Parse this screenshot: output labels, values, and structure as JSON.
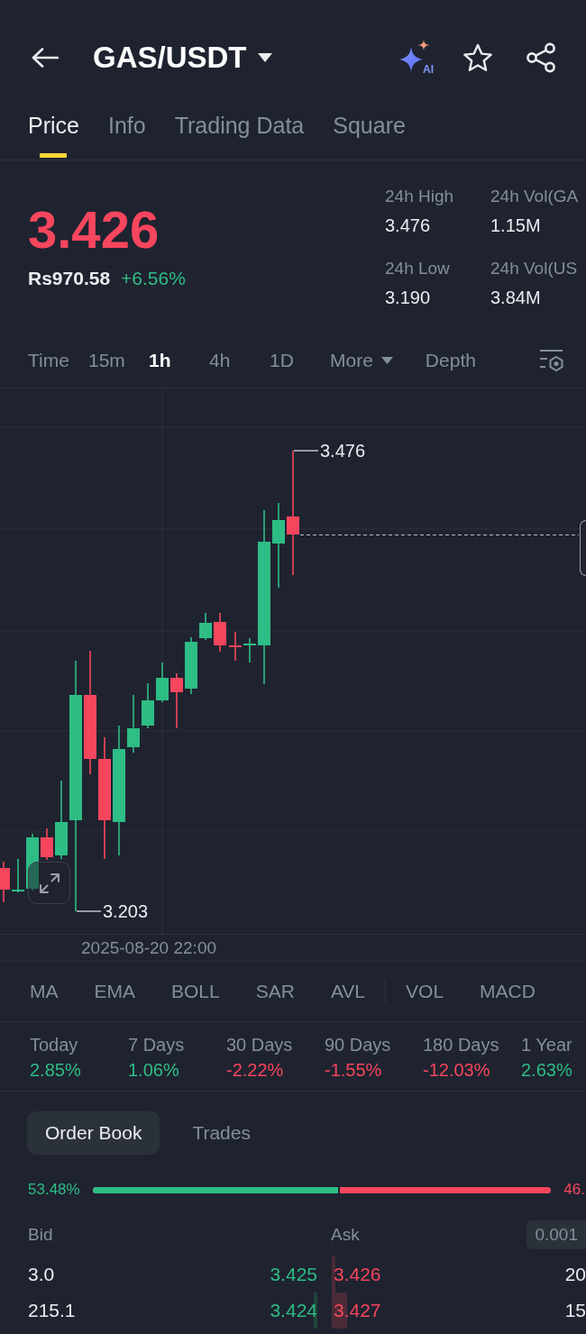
{
  "header": {
    "title": "GAS/USDT",
    "ai_badge": "AI"
  },
  "tabs": [
    {
      "label": "Price",
      "selected": true
    },
    {
      "label": "Info",
      "selected": false
    },
    {
      "label": "Trading Data",
      "selected": false
    },
    {
      "label": "Square",
      "selected": false
    }
  ],
  "ticker": {
    "price": "3.426",
    "price_rising": false,
    "fiat_price": "Rs970.58",
    "change": "+6.56%",
    "change_rising": true
  },
  "stats": [
    {
      "label": "24h High",
      "value": "3.476"
    },
    {
      "label": "24h Vol(GA",
      "value": "1.15M"
    },
    {
      "label": "24h Low",
      "value": "3.190"
    },
    {
      "label": "24h Vol(US",
      "value": "3.84M"
    }
  ],
  "chart_tabs": [
    {
      "label": "Time",
      "selected": false,
      "dropdown": false
    },
    {
      "label": "15m",
      "selected": false,
      "dropdown": false
    },
    {
      "label": "1h",
      "selected": true,
      "dropdown": false
    },
    {
      "label": "4h",
      "selected": false,
      "dropdown": false
    },
    {
      "label": "1D",
      "selected": false,
      "dropdown": false
    },
    {
      "label": "More",
      "selected": false,
      "dropdown": true
    },
    {
      "label": "Depth",
      "selected": false,
      "dropdown": false
    }
  ],
  "chart": {
    "high_label": "3.476",
    "low_label": "3.203",
    "time_label": "2025-08-20 22:00"
  },
  "indicators": {
    "main": [
      "MA",
      "EMA",
      "BOLL",
      "SAR",
      "AVL"
    ],
    "sub": [
      "VOL",
      "MACD"
    ]
  },
  "performance": [
    {
      "label": "Today",
      "value": "2.85%",
      "rising": true
    },
    {
      "label": "7 Days",
      "value": "1.06%",
      "rising": true
    },
    {
      "label": "30 Days",
      "value": "-2.22%",
      "rising": false
    },
    {
      "label": "90 Days",
      "value": "-1.55%",
      "rising": false
    },
    {
      "label": "180 Days",
      "value": "-12.03%",
      "rising": false
    },
    {
      "label": "1 Year",
      "value": "2.63%",
      "rising": true
    }
  ],
  "order_book": {
    "tabs": [
      {
        "label": "Order Book",
        "selected": true
      },
      {
        "label": "Trades",
        "selected": false
      }
    ],
    "bid_ratio": "53.48%",
    "ask_ratio": "46.",
    "level": 0.5348,
    "bid_header": "Bid",
    "ask_header": "Ask",
    "precision": "0.001",
    "rows": [
      {
        "bid": {
          "amount": "3.0",
          "price": "3.425"
        },
        "ask": {
          "price": "3.426",
          "amount": "20",
          "level": 0.015
        }
      },
      {
        "bid": {
          "amount": "215.1",
          "price": "3.424",
          "level": 0.012
        },
        "ask": {
          "price": "3.427",
          "amount": "15",
          "level": 0.06
        }
      }
    ]
  }
}
